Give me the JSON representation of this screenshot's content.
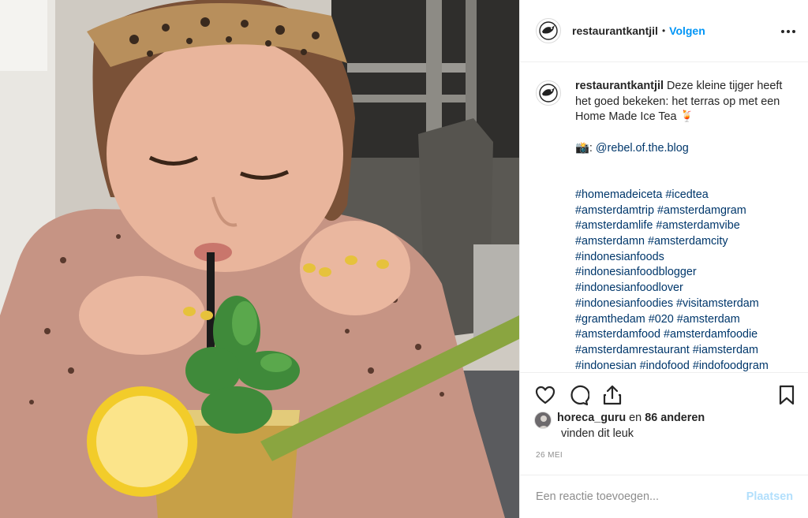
{
  "account": {
    "username": "restaurantkantjil",
    "separator": "•",
    "follow_label": "Volgen"
  },
  "photo": {
    "alt": "Meisje drinkt Home Made Ice Tea met rietje"
  },
  "caption": {
    "username": "restaurantkantjil",
    "line1": "Deze kleine tijger heeft het goed bekeken: het terras op met een Home Made Ice Tea 🍹",
    "credit_prefix": "📸: ",
    "credit_mention": "@rebel.of.the.blog",
    "hashtags": [
      "#homemadeiceta #icedtea",
      "#amsterdamtrip #amsterdamgram",
      "#amsterdamlife #amsterdamvibe",
      "#amsterdamn #amsterdamcity",
      "#indonesianfoods",
      "#indonesianfoodblogger",
      "#indonesianfoodlover",
      "#indonesianfoodies #visitamsterdam",
      "#gramthedam #020 #amsterdam",
      "#amsterdamfood #amsterdamfoodie",
      "#amsterdamrestaurant #iamsterdam",
      "#indonesian #indofood #indofoodgram"
    ]
  },
  "likes": {
    "user": "horeca_guru",
    "connector": " en ",
    "others": "86 anderen",
    "suffix": "vinden dit leuk"
  },
  "date": "26 MEI",
  "comment": {
    "placeholder": "Een reactie toevoegen...",
    "post_label": "Plaatsen"
  },
  "colors": {
    "accent": "#0095f6",
    "post_disabled": "#b2dffc",
    "meta_gray": "#8e8e8e",
    "hashtag": "#00376b"
  },
  "icons": {
    "like": "heart-icon",
    "comment": "comment-icon",
    "share": "share-icon",
    "save": "bookmark-icon",
    "more": "more-options-icon"
  }
}
